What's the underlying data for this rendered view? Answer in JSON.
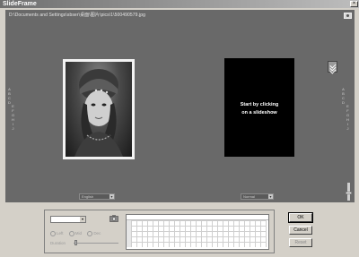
{
  "window": {
    "title": "SlideFrame",
    "close_glyph": "×"
  },
  "canvas": {
    "file_path": "D:\\Documents and Settings\\sbser\\桌面\\图片\\pics\\1\\500490579.jpg",
    "slideshow_message_line1": "Start by clicking",
    "slideshow_message_line2": "on a slideshow",
    "left_side_label_1": "",
    "left_side_label_2": "",
    "right_side_label_1": "",
    "right_side_label_2": "",
    "combo_left": "English",
    "combo_right": "Normal"
  },
  "panel": {
    "radio_1": "Left",
    "radio_2": "Mid",
    "radio_3": "Dec",
    "duration_label": "Duration"
  },
  "buttons": {
    "ok": "OK",
    "cancel": "Cancel",
    "reset": "Reset"
  },
  "colors": {
    "canvas_bg": "#696969",
    "window_bg": "#d4d0c8"
  }
}
